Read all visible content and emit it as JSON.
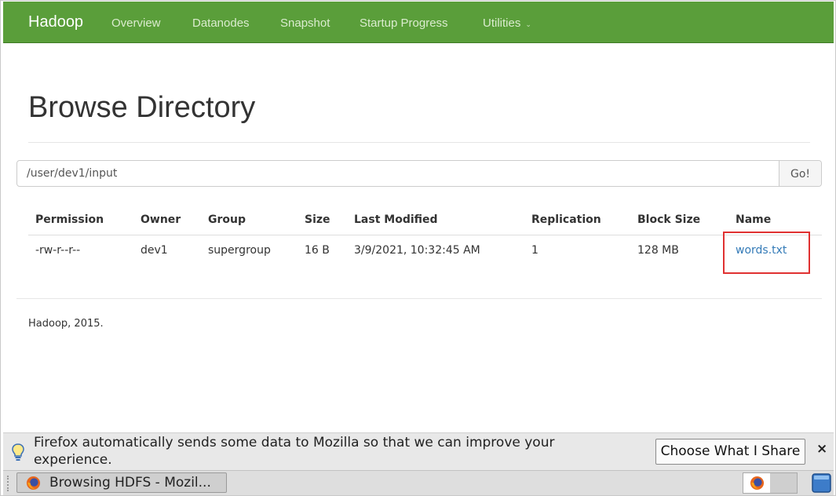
{
  "navbar": {
    "brand": "Hadoop",
    "items": [
      "Overview",
      "Datanodes",
      "Snapshot",
      "Startup Progress",
      "Utilities"
    ],
    "caret": "⌄",
    "color": "#5a9e3a"
  },
  "page": {
    "title": "Browse Directory",
    "path_value": "/user/dev1/input",
    "go_label": "Go!"
  },
  "table": {
    "headers": [
      "Permission",
      "Owner",
      "Group",
      "Size",
      "Last Modified",
      "Replication",
      "Block Size",
      "Name"
    ],
    "rows": [
      [
        "-rw-r--r--",
        "dev1",
        "supergroup",
        "16 B",
        "3/9/2021, 10:32:45 AM",
        "1",
        "128 MB",
        "words.txt"
      ]
    ]
  },
  "footer": {
    "text": "Hadoop, 2015."
  },
  "notification": {
    "message": "Firefox automatically sends some data to Mozilla so that we can improve your experience.",
    "button_label": "Choose What I Share",
    "close_glyph": "×",
    "icon": "lightbulb-icon"
  },
  "taskbar": {
    "window_label": "Browsing HDFS - Mozil...",
    "icon": "firefox-icon"
  }
}
